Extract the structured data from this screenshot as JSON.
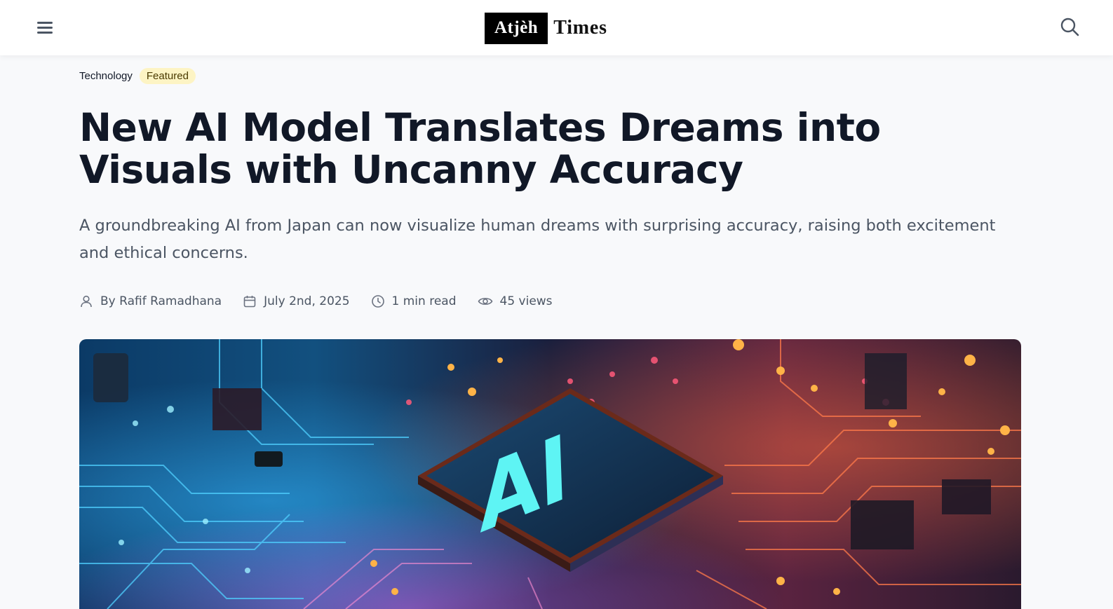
{
  "header": {
    "logo_box": "Atjèh",
    "logo_text": "Times",
    "menu_icon": "hamburger-icon",
    "search_icon": "search-icon"
  },
  "article": {
    "category": "Technology",
    "badge": "Featured",
    "title": "New AI Model Translates Dreams into Visuals with Uncanny Accuracy",
    "subtitle": "A groundbreaking AI from Japan can now visualize human dreams with surprising accuracy, raising both excitement and ethical concerns.",
    "meta": {
      "author": "By Rafif Ramadhana",
      "date": "July 2nd, 2025",
      "read_time": "1 min read",
      "views": "45 views"
    },
    "hero_label": "AI"
  },
  "colors": {
    "text": "#111827",
    "muted": "#4b5563",
    "badge_bg": "#fdf4c4",
    "background": "#f8f9fb"
  }
}
